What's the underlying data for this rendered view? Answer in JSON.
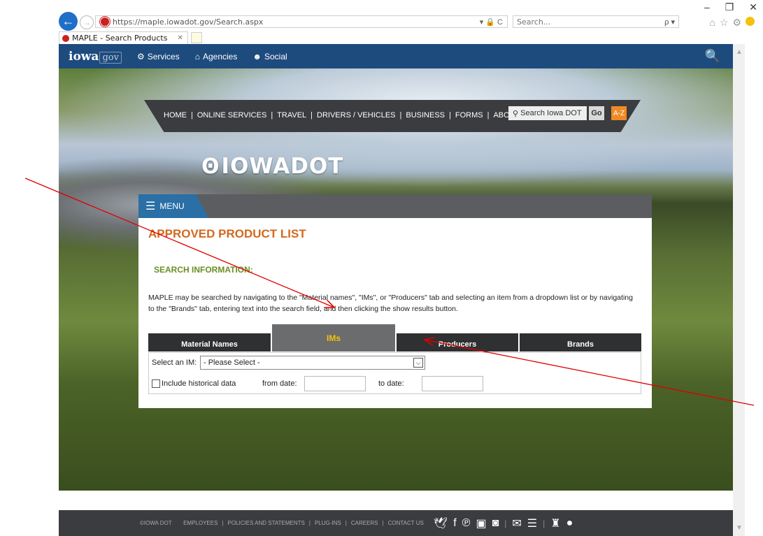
{
  "browser": {
    "url": "https://maple.iowadot.gov/Search.aspx",
    "addr_controls": "▾ 🔒 C",
    "search_placeholder": "Search...",
    "search_icon": "ρ ▾",
    "tab_title": "MAPLE - Search Products",
    "tab_close": "✕",
    "window_controls": [
      "–",
      "❐",
      "✕"
    ],
    "toolbar_icons": [
      "⌂",
      "☆",
      "⚙"
    ]
  },
  "gov_bar": {
    "logo": "iowa",
    "logo_suffix": "gov",
    "links": [
      {
        "icon": "gears-icon",
        "glyph": "⚙",
        "label": "Services"
      },
      {
        "icon": "building-icon",
        "glyph": "⌂",
        "label": "Agencies"
      },
      {
        "icon": "people-icon",
        "glyph": "☻",
        "label": "Social"
      }
    ],
    "search_glyph": "🔍"
  },
  "dot_nav": {
    "links": [
      "HOME",
      "ONLINE SERVICES",
      "TRAVEL",
      "DRIVERS / VEHICLES",
      "BUSINESS",
      "FORMS",
      "ABOUT"
    ],
    "search_placeholder": "Search Iowa DOT",
    "go_label": "Go",
    "az_label": "A-Z"
  },
  "logo_text": "IOWADOT",
  "menu_label": "MENU",
  "main": {
    "title": "APPROVED PRODUCT LIST",
    "search_info_heading": "SEARCH INFORMATION:",
    "description": "MAPLE may be searched by navigating to the \"Material names\", \"IMs\", or \"Producers\" tab and selecting an item from a dropdown list or by navigating to the \"Brands\" tab, entering text into the search field, and then clicking the show results button.",
    "tabs": [
      {
        "label": "Material Names",
        "active": false
      },
      {
        "label": "IMs",
        "active": true
      },
      {
        "label": "Producers",
        "active": false
      },
      {
        "label": "Brands",
        "active": false
      }
    ],
    "im_label": "Select an IM:",
    "im_selected": "- Please Select -",
    "historical_label": "Include historical data",
    "from_label": "from date:",
    "to_label": "to date:"
  },
  "footer": {
    "links": [
      "©IOWA DOT",
      "EMPLOYEES",
      "POLICIES AND STATEMENTS",
      "PLUG-INS",
      "CAREERS",
      "CONTACT US"
    ],
    "social_icons": [
      "twitter-icon",
      "facebook-icon",
      "pinterest-icon",
      "youtube-icon",
      "instagram-icon",
      "email-icon",
      "rss-icon",
      "android-icon",
      "apple-icon"
    ]
  },
  "colors": {
    "gov_bar": "#1e4b7e",
    "menu_tab": "#2a6fa5",
    "title_orange": "#d2691e",
    "heading_green": "#6b8e23",
    "active_tab_text": "#f4c20d",
    "annotation_arrow": "#e00000"
  }
}
